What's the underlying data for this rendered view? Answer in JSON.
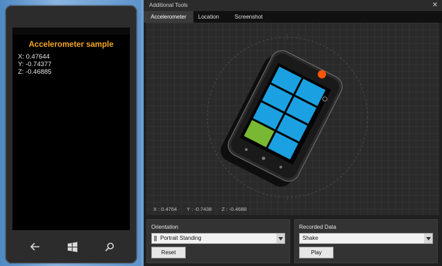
{
  "emulator": {
    "app_title": "Accelerometer sample",
    "readings": [
      "X: 0.47644",
      "Y: -0.74377",
      "Z: -0.46885"
    ],
    "hardware_buttons": [
      "back-icon",
      "windows-icon",
      "search-icon"
    ],
    "toolbar_icons": [
      "minimize-icon",
      "close-icon"
    ]
  },
  "tools": {
    "title": "Additional Tools",
    "close_glyph": "✕",
    "tabs": [
      {
        "label": "Accelerometer",
        "active": true
      },
      {
        "label": "Location",
        "active": false
      },
      {
        "label": "Screenshot",
        "active": false
      }
    ],
    "coords": {
      "x": "X : 0.4764",
      "y": "Y : -0.7438",
      "z": "Z : -0.4688"
    },
    "orientation": {
      "label": "Orientation",
      "selected": "Portrait Standing",
      "reset_label": "Reset"
    },
    "recorded": {
      "label": "Recorded Data",
      "selected": "Shake",
      "play_label": "Play"
    }
  },
  "colors": {
    "title_accent": "#f5a623",
    "tile_blue": "#1ba1e2",
    "tile_green": "#78b833",
    "record_orange": "#ff5500"
  }
}
